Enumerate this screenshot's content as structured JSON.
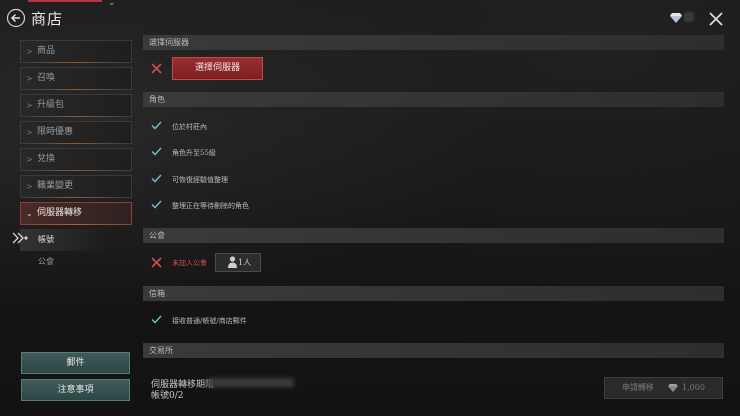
{
  "header": {
    "title": "商店"
  },
  "sidebar": {
    "items": [
      {
        "label": "商品"
      },
      {
        "label": "召喚"
      },
      {
        "label": "升級包"
      },
      {
        "label": "限時優惠"
      },
      {
        "label": "兌換"
      },
      {
        "label": "職業變更"
      },
      {
        "label": "伺服器轉移"
      }
    ],
    "sub_items": [
      {
        "label": "帳號"
      },
      {
        "label": "公會"
      }
    ],
    "mail_button": "郵件",
    "notice_button": "注意事項"
  },
  "server_section": {
    "header": "選擇伺服器",
    "button": "選擇伺服器"
  },
  "character_section": {
    "header": "角色",
    "conditions": [
      "位於村莊內",
      "角色升至55級",
      "可恢復經驗值整理",
      "整理正在等待刪除的角色"
    ]
  },
  "guild_section": {
    "header": "公會",
    "status": "未加入公會",
    "people": "1人"
  },
  "mail_section": {
    "header": "信箱",
    "condition": "接收普通/帳號/商店郵件"
  },
  "exchange_section": {
    "header": "交易所"
  },
  "footer": {
    "deadline_label": "伺服器轉移期限",
    "account_count": "帳號0/2",
    "apply_label": "申請轉移",
    "apply_cost": "1,000"
  },
  "colors": {
    "accent_red": "#9b2e2e",
    "check_teal": "#6fb9c4",
    "teal_button": "#3e5c5a"
  }
}
